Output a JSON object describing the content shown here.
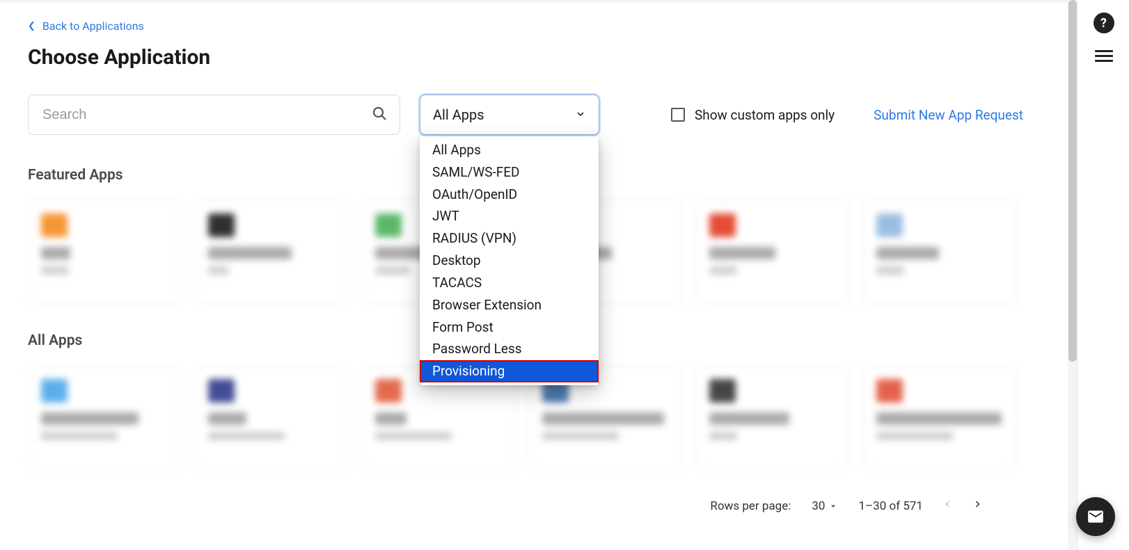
{
  "back_link": "Back to Applications",
  "page_title": "Choose Application",
  "search": {
    "placeholder": "Search"
  },
  "filter": {
    "selected": "All Apps",
    "options": [
      "All Apps",
      "SAML/WS-FED",
      "OAuth/OpenID",
      "JWT",
      "RADIUS (VPN)",
      "Desktop",
      "TACACS",
      "Browser Extension",
      "Form Post",
      "Password Less",
      "Provisioning"
    ],
    "highlighted_index": 10
  },
  "checkbox_label": "Show custom apps only",
  "submit_link": "Submit New App Request",
  "sections": {
    "featured": "Featured Apps",
    "all": "All Apps"
  },
  "featured_cards": [
    {
      "color": "#f58a1f",
      "name_w": 42,
      "sub_w": 40
    },
    {
      "color": "#1a1a1a",
      "name_w": 120,
      "sub_w": 30
    },
    {
      "color": "#4db05b",
      "name_w": 80,
      "sub_w": 50
    },
    {
      "color": "#cccccc",
      "name_w": 100,
      "sub_w": 40
    },
    {
      "color": "#e03b1f",
      "name_w": 95,
      "sub_w": 40
    },
    {
      "color": "#8fb7e0",
      "name_w": 90,
      "sub_w": 40
    }
  ],
  "all_cards": [
    {
      "color": "#4aa8e8",
      "name_w": 140,
      "sub_w": 110
    },
    {
      "color": "#2e3a8c",
      "name_w": 55,
      "sub_w": 110
    },
    {
      "color": "#e05a3a",
      "name_w": 45,
      "sub_w": 110
    },
    {
      "color": "#3a6fa8",
      "name_w": 175,
      "sub_w": 110
    },
    {
      "color": "#333333",
      "name_w": 115,
      "sub_w": 40
    },
    {
      "color": "#e0523a",
      "name_w": 180,
      "sub_w": 110
    }
  ],
  "pagination": {
    "rows_label": "Rows per page:",
    "rows_value": "30",
    "range": "1–30 of 571"
  }
}
